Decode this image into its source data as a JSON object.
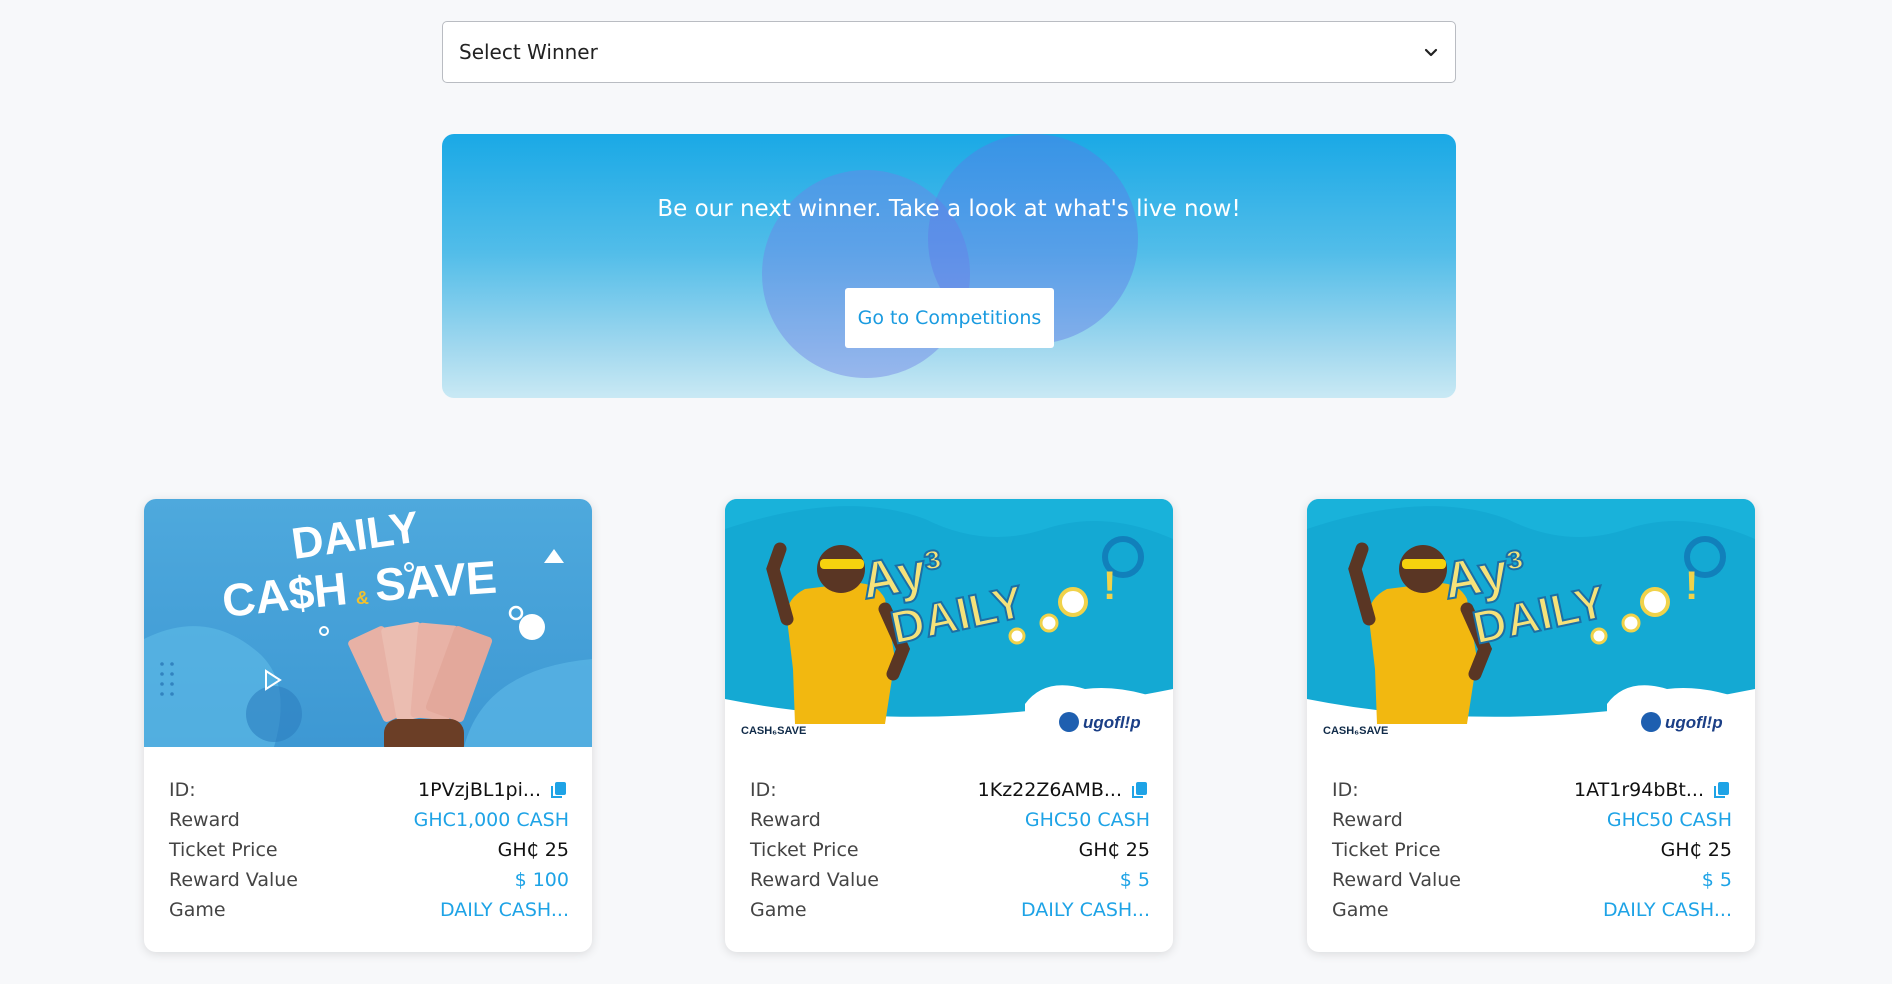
{
  "select": {
    "label": "Select Winner"
  },
  "banner": {
    "headline": "Be our next winner. Take a look at what's live now!",
    "cta_label": "Go to Competitions"
  },
  "cards": [
    {
      "image": {
        "title_line1": "DAILY",
        "title_line2": "CA$H",
        "title_amp": "&",
        "title_line3": "SAVE"
      },
      "fields": {
        "id_label": "ID:",
        "id_value": "1PVzjBL1pi...",
        "reward_label": "Reward",
        "reward_value": "GHC1,000 CASH",
        "ticket_label": "Ticket Price",
        "ticket_value": "GH₵ 25",
        "reward_value_label": "Reward Value",
        "reward_value_value": "$ 100",
        "game_label": "Game",
        "game_value": "DAILY CASH..."
      }
    },
    {
      "image": {
        "headline_a": "Ay³",
        "headline_b": "DAILY",
        "corner_small": "CASH₆SAVE",
        "brand": "ugofl!p"
      },
      "fields": {
        "id_label": "ID:",
        "id_value": "1Kz22Z6AMB...",
        "reward_label": "Reward",
        "reward_value": "GHC50 CASH",
        "ticket_label": "Ticket Price",
        "ticket_value": "GH₵ 25",
        "reward_value_label": "Reward Value",
        "reward_value_value": "$ 5",
        "game_label": "Game",
        "game_value": "DAILY CASH..."
      }
    },
    {
      "image": {
        "headline_a": "Ay³",
        "headline_b": "DAILY",
        "corner_small": "CASH₆SAVE",
        "brand": "ugofl!p"
      },
      "fields": {
        "id_label": "ID:",
        "id_value": "1AT1r94bBt...",
        "reward_label": "Reward",
        "reward_value": "GHC50 CASH",
        "ticket_label": "Ticket Price",
        "ticket_value": "GH₵ 25",
        "reward_value_label": "Reward Value",
        "reward_value_value": "$ 5",
        "game_label": "Game",
        "game_value": "DAILY CASH..."
      }
    }
  ],
  "colors": {
    "accent": "#1ea3e6",
    "banner_top": "#1aa9e6",
    "card_bg": "#ffffff",
    "page_bg": "#f7f8fa"
  },
  "icons": {
    "select_chevron": "chevron-down-icon",
    "copy": "copy-icon"
  }
}
